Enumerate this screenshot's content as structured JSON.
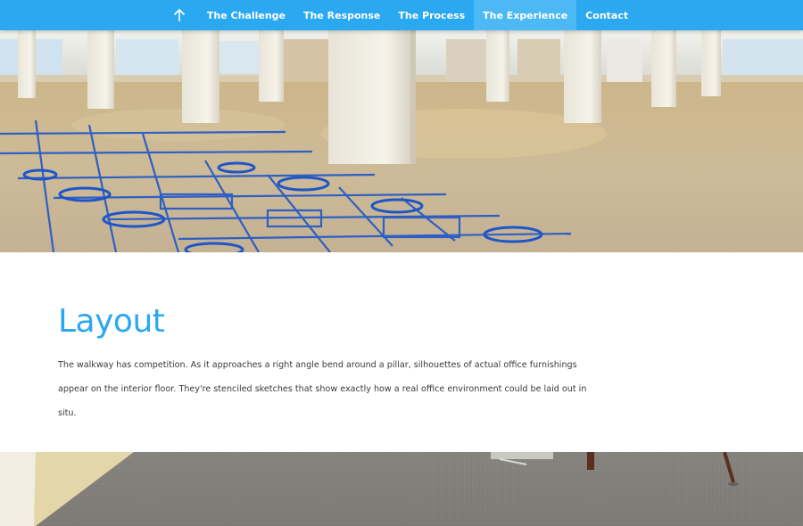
{
  "nav": {
    "up_icon": "arrow-up-icon",
    "items": [
      {
        "label": "The Challenge",
        "active": false
      },
      {
        "label": "The Response",
        "active": false
      },
      {
        "label": "The Process",
        "active": false
      },
      {
        "label": "The Experience",
        "active": true
      },
      {
        "label": "Contact",
        "active": false
      }
    ]
  },
  "colors": {
    "accent": "#2aa8f0",
    "nav_active": "#4cb8f4",
    "body_text": "#3a3a3a",
    "floor_stencil_blue": "#1e56c8"
  },
  "section": {
    "title": "Layout",
    "body_line_1": "The walkway has competition. As it approaches a right angle bend around a pillar, silhouettes of actual office furnishings",
    "body_line_2": "appear on the interior floor. They're stenciled sketches that show exactly how a real office environment could be laid out in situ."
  }
}
